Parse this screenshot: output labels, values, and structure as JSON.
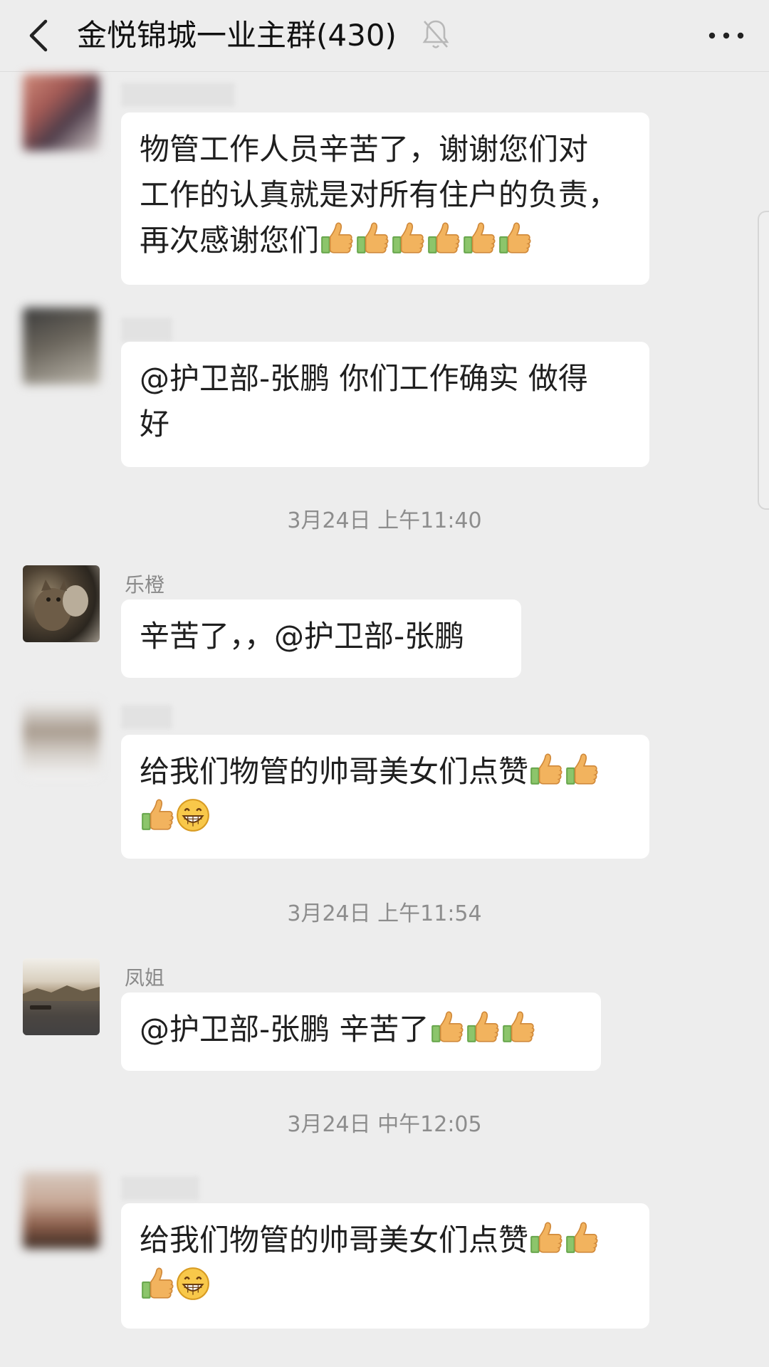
{
  "header": {
    "title": "金悦锦城一业主群(430)",
    "icons": {
      "back": "chevron-left-icon",
      "mute": "bell-off-icon",
      "more": "ellipsis-icon"
    }
  },
  "messages": [
    {
      "sender": "",
      "lines": [
        "物管工作人员辛苦了，谢谢您们对",
        "工作的认真就是对所有住户的负责，",
        "再次感谢您们"
      ],
      "emoji": [
        "thumbs-up",
        "thumbs-up",
        "thumbs-up",
        "thumbs-up",
        "thumbs-up",
        "thumbs-up"
      ]
    },
    {
      "sender": "",
      "lines": [
        "@护卫部-张鹏 你们工作确实 做得",
        "好"
      ]
    },
    {
      "timestamp": "3月24日 上午11:40"
    },
    {
      "sender": "乐橙",
      "lines": [
        "辛苦了，，@护卫部-张鹏"
      ]
    },
    {
      "sender": "",
      "lines": [
        "给我们物管的帅哥美女们点赞",
        ""
      ],
      "emoji_line1": [
        "thumbs-up",
        "thumbs-up"
      ],
      "emoji_line2": [
        "thumbs-up",
        "grin"
      ]
    },
    {
      "timestamp": "3月24日 上午11:54"
    },
    {
      "sender": "凤姐",
      "lines": [
        "@护卫部-张鹏  辛苦了"
      ],
      "emoji": [
        "thumbs-up",
        "thumbs-up",
        "thumbs-up"
      ]
    },
    {
      "timestamp": "3月24日 中午12:05"
    },
    {
      "sender": "",
      "lines": [
        "给我们物管的帅哥美女们点赞",
        ""
      ],
      "emoji_line1": [
        "thumbs-up",
        "thumbs-up"
      ],
      "emoji_line2": [
        "thumbs-up",
        "grin"
      ]
    }
  ],
  "colors": {
    "background": "#ededed",
    "bubble": "#ffffff",
    "timestamp": "#8d8d8d",
    "thumb": "#f2b35e",
    "cuff": "#6aa84f"
  }
}
